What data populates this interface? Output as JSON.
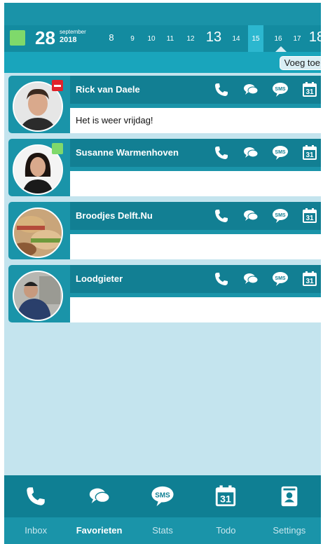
{
  "date": {
    "day": "28",
    "month": "september",
    "year": "2018"
  },
  "calendar_days": [
    "8",
    "9",
    "10",
    "11",
    "12",
    "13",
    "14",
    "15",
    "16",
    "17",
    "18"
  ],
  "selected_day": "15",
  "add_button_label": "Voeg toe",
  "contacts": [
    {
      "name": "Rick van Daele",
      "message": "Het is weer vrijdag!",
      "status": "busy"
    },
    {
      "name": "Susanne Warmenhoven",
      "message": "",
      "status": "available"
    },
    {
      "name": "Broodjes Delft.Nu",
      "message": "",
      "status": ""
    },
    {
      "name": "Loodgieter",
      "message": "",
      "status": ""
    }
  ],
  "calendar_icon_text": "31",
  "sms_icon_text": "SMS",
  "bottom_actions": [
    "phone-icon",
    "chat-icon",
    "sms-icon",
    "calendar-icon",
    "contact-card-icon"
  ],
  "tabs": [
    {
      "label": "Inbox",
      "active": false
    },
    {
      "label": "Favorieten",
      "active": true
    },
    {
      "label": "Stats",
      "active": false
    },
    {
      "label": "Todo",
      "active": false
    },
    {
      "label": "Settings",
      "active": false
    }
  ],
  "colors": {
    "primary": "#1a94a9",
    "dark": "#127f93",
    "background": "#c4e4ee",
    "busy": "#e0242b",
    "available": "#7fd96b"
  }
}
